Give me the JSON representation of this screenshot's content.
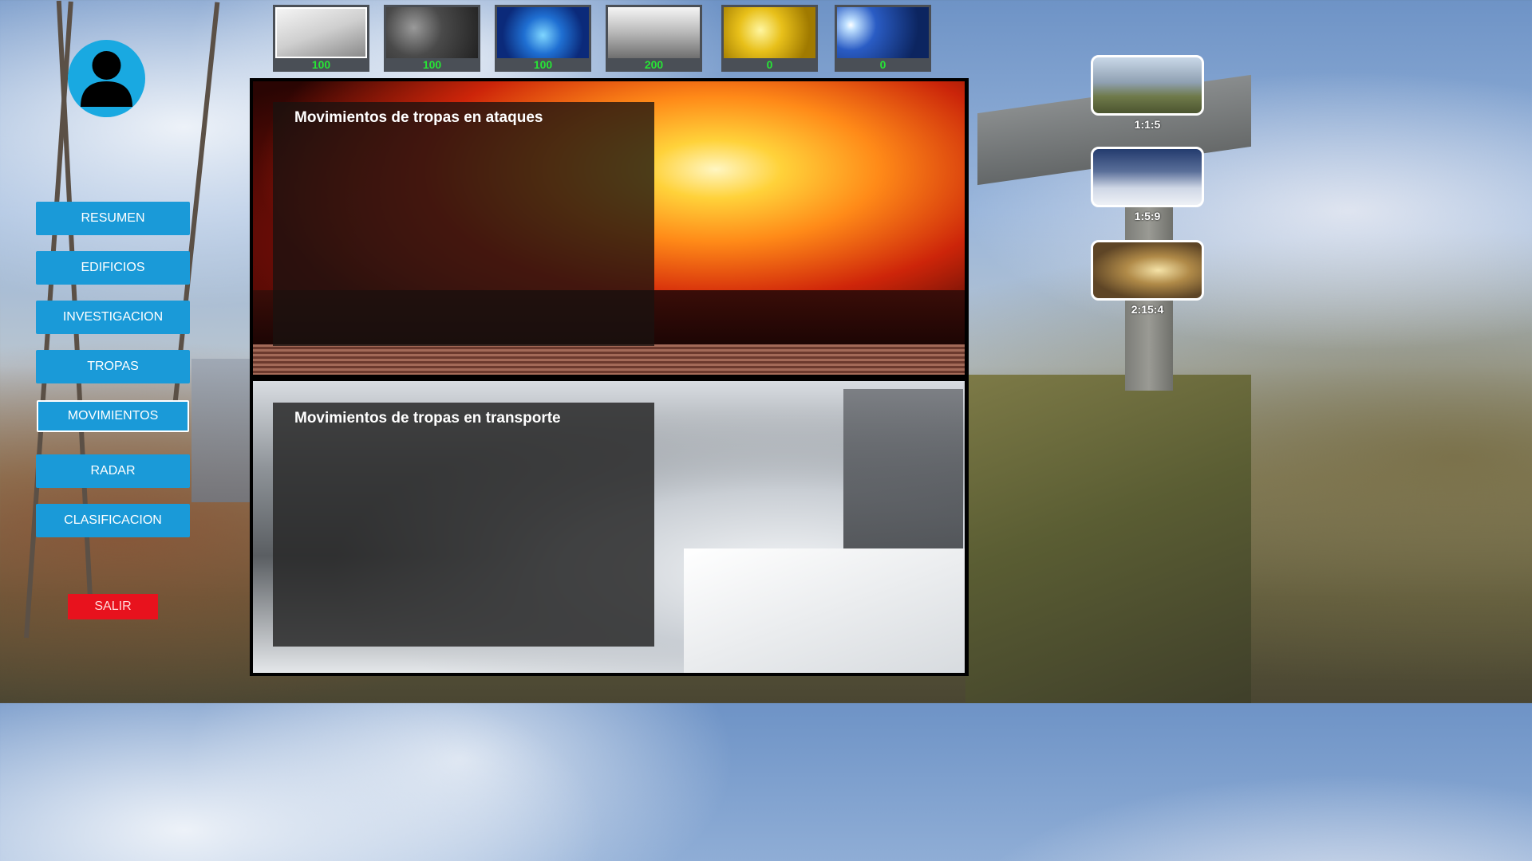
{
  "avatar": {
    "icon": "user-silhouette-icon",
    "color": "#19a9e1"
  },
  "nav": {
    "items": [
      {
        "label": "RESUMEN"
      },
      {
        "label": "EDIFICIOS"
      },
      {
        "label": "INVESTIGACION"
      },
      {
        "label": "TROPAS"
      },
      {
        "label": "MOVIMIENTOS",
        "active": true
      },
      {
        "label": "RADAR"
      },
      {
        "label": "CLASIFICACION"
      }
    ],
    "exit_label": "SALIR",
    "button_color": "#1a9ad8",
    "exit_color": "#e8121d"
  },
  "resources": [
    {
      "icon": "machine-parts-icon",
      "value": "100"
    },
    {
      "icon": "hexagon-mesh-icon",
      "value": "100"
    },
    {
      "icon": "microchip-icon",
      "value": "100"
    },
    {
      "icon": "steel-beams-icon",
      "value": "200"
    },
    {
      "icon": "fuel-oil-icon",
      "value": "0"
    },
    {
      "icon": "solar-panel-icon",
      "value": "0"
    }
  ],
  "main": {
    "attacks_title": "Movimientos de tropas en ataques",
    "transport_title": "Movimientos de tropas en transporte"
  },
  "markers": [
    {
      "coord": "1:1:5",
      "icon": "ruined-bridge-thumbnail-icon"
    },
    {
      "coord": "1:5:9",
      "icon": "frozen-city-thumbnail-icon"
    },
    {
      "coord": "2:15:4",
      "icon": "sunset-city-thumbnail-icon"
    }
  ]
}
